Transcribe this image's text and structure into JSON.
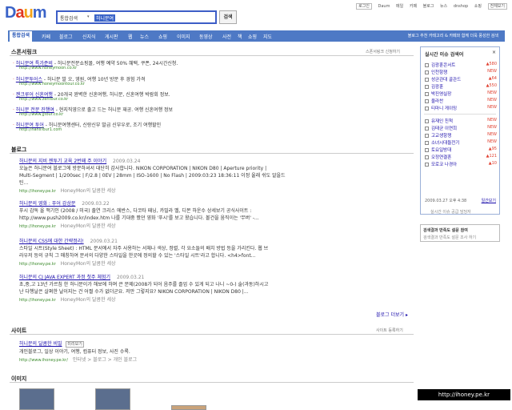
{
  "search": {
    "selector": "통합검색",
    "query": "허니문여",
    "button": "검색"
  },
  "toplinks": [
    "로그인",
    "Daum",
    "메일",
    "카페",
    "블로그",
    "뉴스",
    "dnshop",
    "쇼핑",
    "전체보기"
  ],
  "tabs": [
    "통합검색",
    "카페",
    "블로그",
    "신지식",
    "게시판",
    "웹",
    "뉴스",
    "쇼핑",
    "이미지",
    "동영상",
    "사전",
    "책",
    "쇼핑",
    "지도"
  ],
  "tabbar_notice": "블로그 추천 카테고리 & 카페와 함께 더욱 풍성한 검색",
  "sponsor": {
    "title": "스폰서링크",
    "right": "스폰서링크 신청하기",
    "items": [
      {
        "title": "허니문여 특가준비",
        "desc": "- 허니문전문쇼핑몰, 여행 예약 50% 혜택, 쿠폰, 24시간신청.",
        "url": "http://www.honeymoon.co.kr"
      },
      {
        "title": "허니문투어스",
        "desc": "- 허니문 발 오, 영원, 여행 10년 방문 후 경험 가격",
        "url": "http://www.honeymoontour.co.kr"
      },
      {
        "title": "젠크루어 신혼여행",
        "desc": "- 20개국 완벽한 신혼여행, 허니문, 신혼여행 박람회 정보.",
        "url": "http://www.zentour.co.kr"
      },
      {
        "title": "허니문 전문 진행여",
        "desc": "- 현지직영으로 출고 드는 허니문 재공. 여행 신혼여행 정보",
        "url": "http://www.jjtour.co.kr"
      },
      {
        "title": "허니문여 투어",
        "desc": "- 허니문여행센터, 신랑신부 발급 신부우로, 조기 여행할인",
        "url": "http://hansTour1.com"
      }
    ]
  },
  "blog": {
    "title": "블로그",
    "more": "블로그 더보기",
    "posts": [
      {
        "title": "허니문의 지비 젠투기 교육 2번째 주 이야기",
        "date": "2009.03.24",
        "line1": "오늘은 허니문여 블로그에 방문하셔서 대단히 감사합니다. NIKON CORPORATION | NIKON D80 | Aperture priority |",
        "line2": "Multi-Segment | 1/200sec | F/2.8 | 0EV | 28mm | ISO-1600 | No Flash | 2009:03:23 18:36:11 이정 울래 쉬도 알을드",
        "line3": "틴...",
        "source": "http://ihoney.pe.kr",
        "author": "HoneyMon의 달콤한 세상"
      },
      {
        "title": "허니문의 영화 : 푸어 감상문",
        "date": "2009.03.22",
        "line1": "푸시 감독 올 맥기인 (2008 / 미국) 출연 크리스 에반스, 다코타 패닝, 카밀라 벨, 디몬 하운수 상세보기 공식사이트 :",
        "line2": "http://www.push2009.co.kr/index.htm 나를 기대중 봤던 영화 '푸시'를 보고 왔습니다. 볼건을 움직이는 '무버' -...",
        "line3": "",
        "source": "http://ihoney.pe.kr",
        "author": "HoneyMon의 달콤한 세상"
      },
      {
        "title": "허니문의 CSS에 대한 간략정리!",
        "date": "2009.03.21",
        "line1": "스타일 시트(Style Sheet) : HTML 문서에서 자주 사용하는 서체나 색상, 정렬, 각 요소들의 배치 방법 등을 가리킨다. 웹 브",
        "line2": "라우저 등의 규칙 그 매칭하여 문서의 다양한 스타일을 한곳에 정의할 수 있는 '스타일 시트'라고 합니다. <h4>font...",
        "line3": "",
        "source": "http://ihoney.pe.kr",
        "author": "HoneyMon의 달콤한 세상"
      },
      {
        "title": "허니문의 CJ JAVA EXPERT 과정 첫주 체험기",
        "date": "2009.03.21",
        "line1": "초,중,고 13년 가르침 한 허니문이가 해보에 하며 큰 문제(2008가 되어 음주를 졸업 수 있게 되고 나니 ~0-) 술(과동)하시고",
        "line2": "난 다행날은 살펴한 날이지는 건 어쩔 수가 없더군요. 저만 그렇지요? NIKON CORPORATION | NIKON D80 |...",
        "line3": "",
        "source": "http://ihoney.pe.kr",
        "author": "HoneyMon의 달콤한 세상"
      }
    ]
  },
  "site": {
    "title": "사이트",
    "right": "사이트 등록하기",
    "item_title": "허니문의 달콤한 비밀",
    "tag": "미리보기",
    "desc": "개인블로그, 일상 이야기, 여행, 컴퓨터 정보, 사진 수록.",
    "url": "http://www.ihoney.pe.kr/",
    "path": "인터넷 > 블로그 > 개인 블로그"
  },
  "image": {
    "title": "이미지"
  },
  "realtime": {
    "title": "실시간 이슈 검색어",
    "items": [
      {
        "label": "김광훈콘서트",
        "n": "▲580"
      },
      {
        "label": "인천항쟁",
        "n": "NEW"
      },
      {
        "label": "성균관대 골관드",
        "n": "▲64"
      },
      {
        "label": "김광훈",
        "n": "▲550"
      },
      {
        "label": "박진영실장",
        "n": "NEW"
      },
      {
        "label": "울라찬",
        "n": "NEW"
      },
      {
        "label": "티마니 게이밍",
        "n": "NEW"
      },
      {
        "label": "유재인 친척",
        "n": "NEW"
      },
      {
        "label": "김태균 이연희",
        "n": "NEW"
      },
      {
        "label": "고교생항쟁",
        "n": "NEW"
      },
      {
        "label": "소녀시대들전기",
        "n": "NEW"
      },
      {
        "label": "토요일방대",
        "n": "▲95"
      },
      {
        "label": "오정연결혼",
        "n": "▲121"
      },
      {
        "label": "모로코 나경아",
        "n": "▲10"
      }
    ],
    "footer_time": "2009.03.27 오후 4:38",
    "footer_link": "일간보기",
    "foot2": "실시간 이슈 공급 담당자"
  },
  "rb2": {
    "line1": "검색결과 만족도 설문 참여",
    "line2": "검색결과 만족도 설문 조사 하기"
  },
  "watermark": "http://ihoney.pe.kr"
}
